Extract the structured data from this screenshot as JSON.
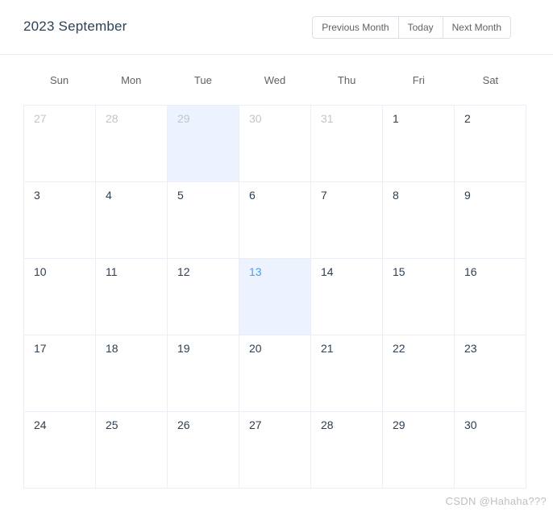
{
  "header": {
    "title": "2023 September",
    "buttons": [
      {
        "label": "Previous Month",
        "name": "prev-month-button"
      },
      {
        "label": "Today",
        "name": "today-button"
      },
      {
        "label": "Next Month",
        "name": "next-month-button"
      }
    ]
  },
  "weekdays": [
    "Sun",
    "Mon",
    "Tue",
    "Wed",
    "Thu",
    "Fri",
    "Sat"
  ],
  "colors": {
    "primary": "#409EFF",
    "selected_background": "#ECF3FE",
    "border": "#EBEEF5",
    "button_border": "#DCDFE6",
    "text_primary": "#2c3e50",
    "text_secondary": "#606266",
    "text_muted": "#C0C4CC",
    "watermark": "#BFBFBF"
  },
  "weeks": [
    [
      {
        "day": "27",
        "adjacent": true,
        "selected": false,
        "today": false
      },
      {
        "day": "28",
        "adjacent": true,
        "selected": false,
        "today": false
      },
      {
        "day": "29",
        "adjacent": true,
        "selected": true,
        "today": false
      },
      {
        "day": "30",
        "adjacent": true,
        "selected": false,
        "today": false
      },
      {
        "day": "31",
        "adjacent": true,
        "selected": false,
        "today": false
      },
      {
        "day": "1",
        "adjacent": false,
        "selected": false,
        "today": false
      },
      {
        "day": "2",
        "adjacent": false,
        "selected": false,
        "today": false
      }
    ],
    [
      {
        "day": "3",
        "adjacent": false,
        "selected": false,
        "today": false
      },
      {
        "day": "4",
        "adjacent": false,
        "selected": false,
        "today": false
      },
      {
        "day": "5",
        "adjacent": false,
        "selected": false,
        "today": false
      },
      {
        "day": "6",
        "adjacent": false,
        "selected": false,
        "today": false
      },
      {
        "day": "7",
        "adjacent": false,
        "selected": false,
        "today": false
      },
      {
        "day": "8",
        "adjacent": false,
        "selected": false,
        "today": false
      },
      {
        "day": "9",
        "adjacent": false,
        "selected": false,
        "today": false
      }
    ],
    [
      {
        "day": "10",
        "adjacent": false,
        "selected": false,
        "today": false
      },
      {
        "day": "11",
        "adjacent": false,
        "selected": false,
        "today": false
      },
      {
        "day": "12",
        "adjacent": false,
        "selected": false,
        "today": false
      },
      {
        "day": "13",
        "adjacent": false,
        "selected": true,
        "today": true
      },
      {
        "day": "14",
        "adjacent": false,
        "selected": false,
        "today": false
      },
      {
        "day": "15",
        "adjacent": false,
        "selected": false,
        "today": false
      },
      {
        "day": "16",
        "adjacent": false,
        "selected": false,
        "today": false
      }
    ],
    [
      {
        "day": "17",
        "adjacent": false,
        "selected": false,
        "today": false
      },
      {
        "day": "18",
        "adjacent": false,
        "selected": false,
        "today": false
      },
      {
        "day": "19",
        "adjacent": false,
        "selected": false,
        "today": false
      },
      {
        "day": "20",
        "adjacent": false,
        "selected": false,
        "today": false
      },
      {
        "day": "21",
        "adjacent": false,
        "selected": false,
        "today": false
      },
      {
        "day": "22",
        "adjacent": false,
        "selected": false,
        "today": false
      },
      {
        "day": "23",
        "adjacent": false,
        "selected": false,
        "today": false
      }
    ],
    [
      {
        "day": "24",
        "adjacent": false,
        "selected": false,
        "today": false
      },
      {
        "day": "25",
        "adjacent": false,
        "selected": false,
        "today": false
      },
      {
        "day": "26",
        "adjacent": false,
        "selected": false,
        "today": false
      },
      {
        "day": "27",
        "adjacent": false,
        "selected": false,
        "today": false
      },
      {
        "day": "28",
        "adjacent": false,
        "selected": false,
        "today": false
      },
      {
        "day": "29",
        "adjacent": false,
        "selected": false,
        "today": false
      },
      {
        "day": "30",
        "adjacent": false,
        "selected": false,
        "today": false
      }
    ]
  ],
  "watermark": "CSDN @Hahaha???"
}
